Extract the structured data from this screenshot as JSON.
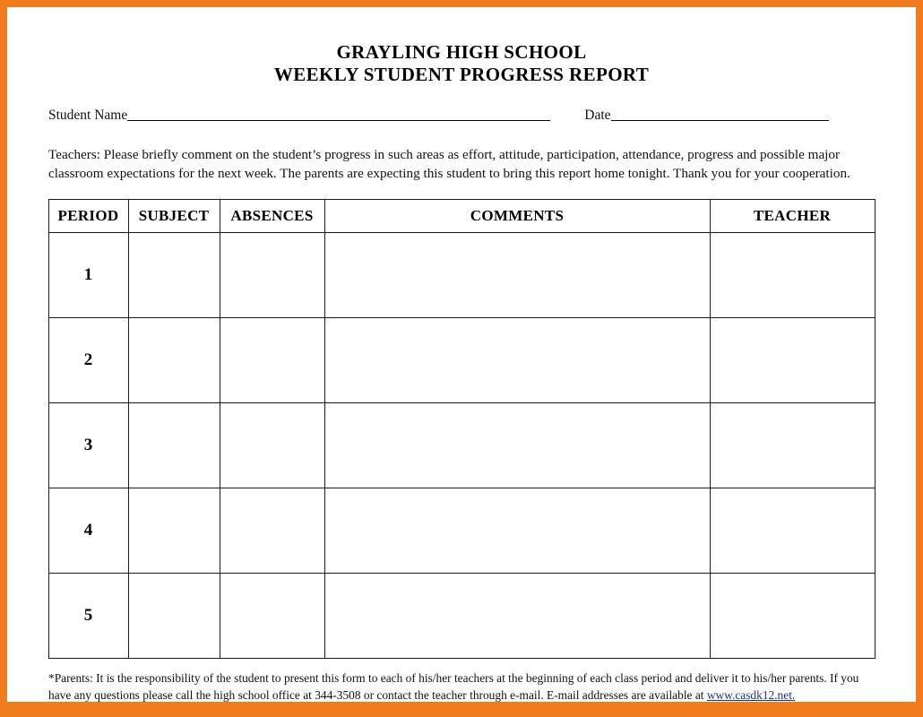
{
  "theme": {
    "border_color": "#f07c1e",
    "page_color": "#ffffff",
    "text_color": "#111111",
    "link_color": "#1f2f8f",
    "table_border_color": "#1a1a1a"
  },
  "header": {
    "title_line1": "GRAYLING HIGH SCHOOL",
    "title_line2": "WEEKLY STUDENT PROGRESS REPORT"
  },
  "fields": {
    "student_name_label": "Student Name",
    "student_name_value": "",
    "date_label": "Date",
    "date_value": ""
  },
  "intro": {
    "text": "Teachers: Please briefly comment on the student’s progress in such areas as effort, attitude, participation, attendance, progress and possible major classroom expectations for the next week.  The parents are expecting this student to bring this report home tonight.  Thank you for your cooperation."
  },
  "table": {
    "columns": [
      "PERIOD",
      "SUBJECT",
      "ABSENCES",
      "COMMENTS",
      "TEACHER"
    ],
    "rows": [
      {
        "period": "1",
        "subject": "",
        "absences": "",
        "comments": "",
        "teacher": ""
      },
      {
        "period": "2",
        "subject": "",
        "absences": "",
        "comments": "",
        "teacher": ""
      },
      {
        "period": "3",
        "subject": "",
        "absences": "",
        "comments": "",
        "teacher": ""
      },
      {
        "period": "4",
        "subject": "",
        "absences": "",
        "comments": "",
        "teacher": ""
      },
      {
        "period": "5",
        "subject": "",
        "absences": "",
        "comments": "",
        "teacher": ""
      }
    ]
  },
  "footnote": {
    "part1": "*Parents: It is the responsibility of the student to present this form to each of his/her teachers at the beginning of each class period and deliver it to his/her parents. If you have any questions please call the high school office at 344-3508 or contact the teacher through e-mail. E-mail addresses are available at ",
    "link_text": "www.casdk12.net."
  }
}
